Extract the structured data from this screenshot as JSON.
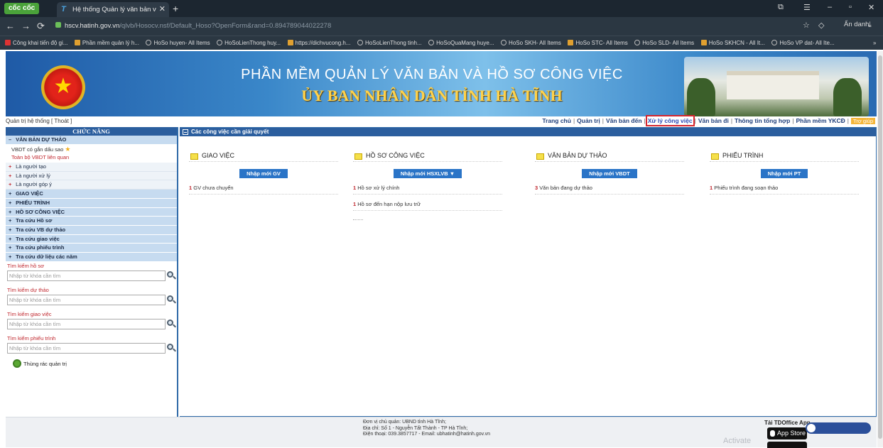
{
  "browser": {
    "name": "cốc cốc",
    "tab_title": "Hệ thống Quản lý văn bản v",
    "tab_close": "✕",
    "new_tab": "+",
    "win_min": "–",
    "win_max": "▫",
    "win_close": "✕",
    "url_host": "hscv.hatinh.gov.vn",
    "url_path": "/qlvb/Hosocv.nsf/Default_Hoso?OpenForm&rand=0.894789044022278",
    "incognito": "Ẩn danh",
    "bookmarks": [
      "Công khai tiến độ gi...",
      "Phần mềm quản lý h...",
      "HoSo huyen- All Items",
      "HoSoLienThong huy...",
      "https://dichvucong.h...",
      "HoSoLienThong tinh...",
      "HoSoQuaMang huye...",
      "HoSo SKH- All Items",
      "HoSo STC- All Items",
      "HoSo SLD- All Items",
      "HoSo SKHCN - All It...",
      "HoSo VP dat- All Ite..."
    ],
    "bookmarks_more": "»"
  },
  "banner": {
    "title": "PHẦN MỀM QUẢN LÝ VĂN BẢN VÀ HỒ SƠ CÔNG VIỆC",
    "subtitle": "ỦY BAN NHÂN DÂN TỈNH HÀ TĨNH",
    "emblem_star": "★"
  },
  "topnav": {
    "admin": "Quản trị hệ thống  [ Thoát ]",
    "items": [
      "Trang chủ",
      "Quản trị",
      "Văn bản đến",
      "Xử lý công việc",
      "Văn bản đi",
      "Thông tin tổng hợp",
      "Phần mềm YKCĐ"
    ],
    "help": "Trợ giúp",
    "sep": "|"
  },
  "sidebar": {
    "header": "CHỨC NĂNG",
    "draft_group": "VĂN BẢN DỰ THẢO",
    "draft_starred": "VBDT có gắn dấu sao",
    "draft_all": "Toàn bộ VBDT liên quan",
    "creator": "Là người tạo",
    "handler": "Là người xử lý",
    "contributor": "Là người góp ý",
    "groups": [
      "GIAO VIỆC",
      "PHIẾU TRÌNH",
      "HỒ SƠ CÔNG VIỆC",
      "Tra cứu Hồ sơ",
      "Tra cứu VB dự thảo",
      "Tra cứu giao việc",
      "Tra cứu phiếu trình",
      "Tra cứu dữ liệu các năm"
    ],
    "searches": [
      {
        "label": "Tìm kiếm hồ sơ",
        "placeholder": "Nhập từ khóa cần tìm"
      },
      {
        "label": "Tìm kiếm dự thảo",
        "placeholder": "Nhập từ khóa cần tìm"
      },
      {
        "label": "Tìm kiếm giao việc",
        "placeholder": "Nhập từ khóa cần tìm"
      },
      {
        "label": "Tìm kiếm phiếu trình",
        "placeholder": "Nhập từ khóa cần tìm"
      }
    ],
    "trash": "Thùng rác quản trị"
  },
  "main": {
    "header": "Các công việc cần giải quyết",
    "columns": [
      {
        "title": "GIAO VIỆC",
        "button": "Nhập mới GV",
        "items": [
          {
            "count": "1",
            "text": "GV chưa chuyển"
          }
        ]
      },
      {
        "title": "HỒ SƠ CÔNG VIỆC",
        "button": "Nhập mới HSXLVB ▼",
        "items": [
          {
            "count": "1",
            "text": "Hồ sơ xử lý chính"
          },
          {
            "count": "1",
            "text": "Hồ sơ đến hạn nộp lưu trữ"
          }
        ]
      },
      {
        "title": "VĂN BẢN DỰ THẢO",
        "button": "Nhập mới VBDT",
        "items": [
          {
            "count": "3",
            "text": "Văn bản đang dự thảo"
          }
        ]
      },
      {
        "title": "PHIẾU TRÌNH",
        "button": "Nhập mới PT",
        "items": [
          {
            "count": "1",
            "text": "Phiếu trình đang soạn thảo"
          }
        ]
      }
    ]
  },
  "footer": {
    "line1": "Đơn vị chủ quản: UBND tỉnh Hà Tĩnh;",
    "line2": "Địa chỉ: Số 1 - Nguyễn Tất Thành - TP Hà Tĩnh;",
    "line3": "Điện thoại: 039.3857717 - Email: ubhatinh@hatinh.gov.vn",
    "app_label": "Tải TDOffice App",
    "app_store": "App Store",
    "activate": "Activate"
  },
  "colors": {
    "accent": "#2b5e9e",
    "highlight_box": "#d6262e",
    "red_text": "#c0262d"
  }
}
